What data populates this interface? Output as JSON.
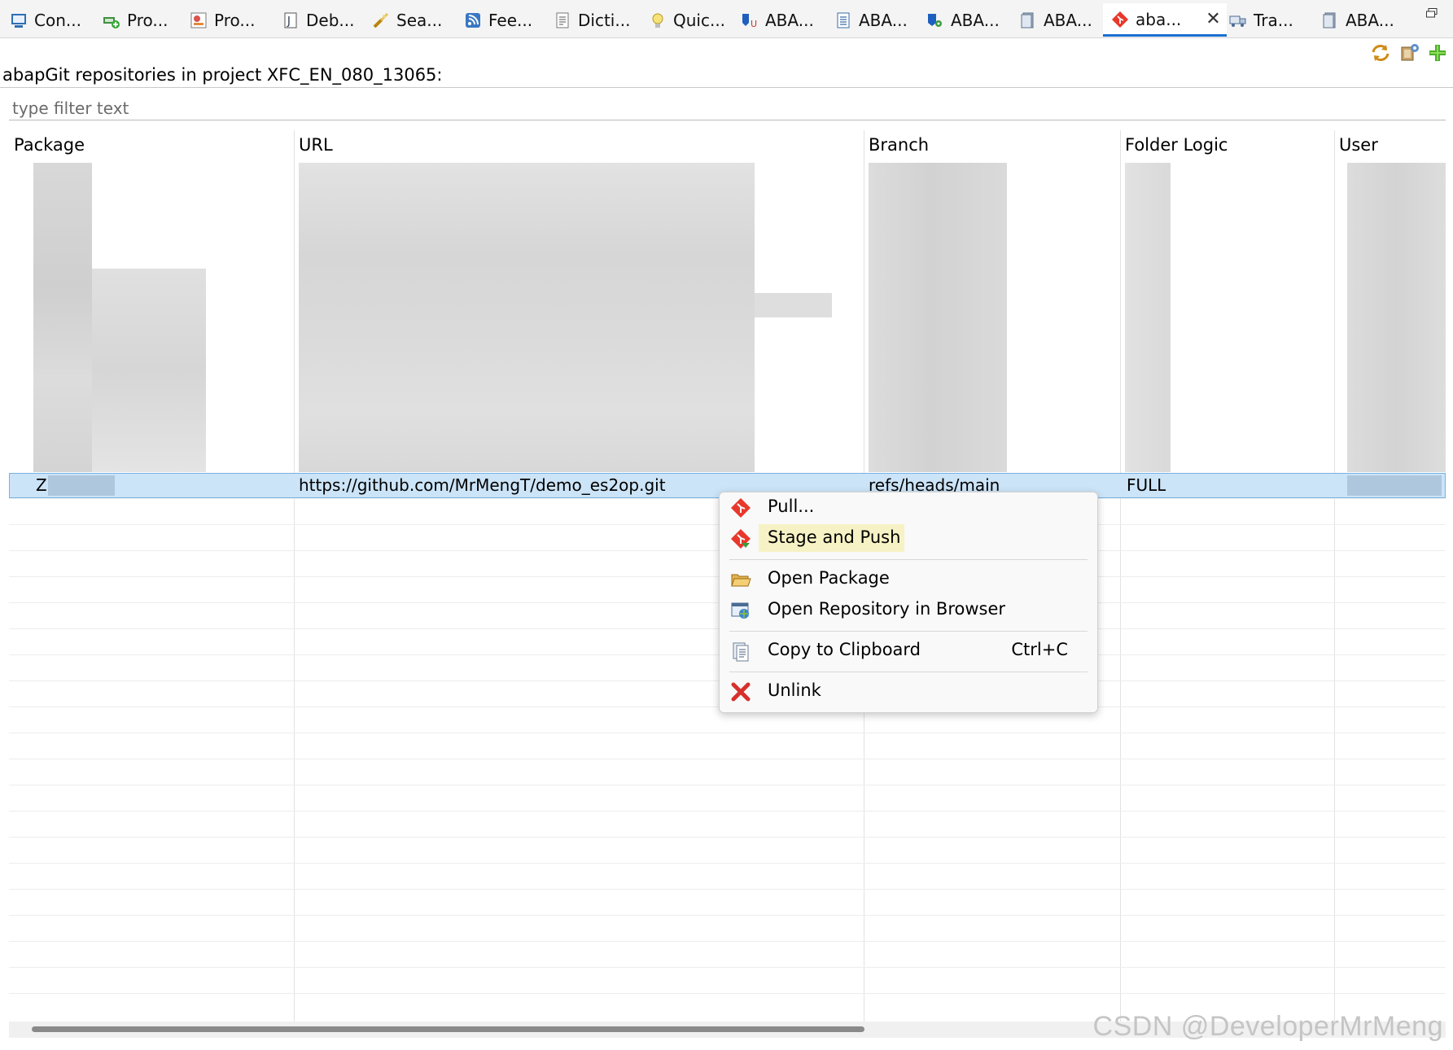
{
  "tabs": [
    {
      "label": "Con...",
      "icon": "console-icon"
    },
    {
      "label": "Pro...",
      "icon": "problems-icon"
    },
    {
      "label": "Pro...",
      "icon": "progress-icon"
    },
    {
      "label": "Deb...",
      "icon": "debug-icon"
    },
    {
      "label": "Sea...",
      "icon": "search-icon"
    },
    {
      "label": "Fee...",
      "icon": "feed-icon"
    },
    {
      "label": "Dicti...",
      "icon": "dictionary-icon"
    },
    {
      "label": "Quic...",
      "icon": "bulb-icon"
    },
    {
      "label": "ABA...",
      "icon": "abap-unit-icon"
    },
    {
      "label": "ABA...",
      "icon": "abap-doc-icon"
    },
    {
      "label": "ABA...",
      "icon": "abap-gear-icon"
    },
    {
      "label": "ABA...",
      "icon": "abap-page-icon"
    },
    {
      "label": "aba...",
      "icon": "abapgit-icon",
      "active": true
    },
    {
      "label": "Tra...",
      "icon": "transport-icon"
    },
    {
      "label": "ABA...",
      "icon": "abap-page-icon"
    }
  ],
  "view": {
    "title": "abapGit repositories in project XFC_EN_080_13065:",
    "filter_placeholder": "type filter text"
  },
  "table": {
    "columns": [
      "Package",
      "URL",
      "Branch",
      "Folder Logic",
      "User"
    ],
    "selected_row": {
      "package": "Z",
      "url": "https://github.com/MrMengT/demo_es2op.git",
      "branch": "refs/heads/main",
      "folder_logic": "FULL"
    }
  },
  "context_menu": {
    "items": [
      {
        "label": "Pull...",
        "icon": "abapgit-pull-icon"
      },
      {
        "label": "Stage and Push",
        "icon": "abapgit-stage-push-icon",
        "highlighted": true
      },
      {
        "label": "Open Package",
        "icon": "folder-open-icon"
      },
      {
        "label": "Open Repository in Browser",
        "icon": "browser-icon"
      },
      {
        "label": "Copy to Clipboard",
        "shortcut": "Ctrl+C",
        "icon": "clipboard-icon"
      },
      {
        "label": "Unlink",
        "icon": "unlink-icon"
      }
    ]
  },
  "watermark": "CSDN @DeveloperMrMeng"
}
